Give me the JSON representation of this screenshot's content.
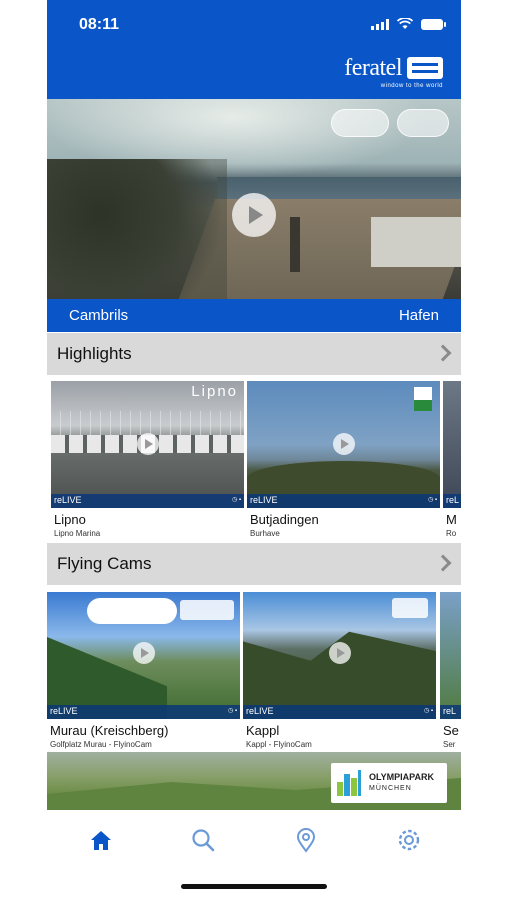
{
  "status_bar": {
    "time": "08:11"
  },
  "brand": {
    "name": "feratel",
    "tagline": "window to the world"
  },
  "hero": {
    "location": "Cambrils",
    "camera": "Hafen"
  },
  "sections": {
    "highlights": {
      "title": "Highlights",
      "cards": [
        {
          "title": "Lipno",
          "subtitle": "Lipno Marina",
          "badge": "reLIVE",
          "overlay_text": "Lipno"
        },
        {
          "title": "Butjadingen",
          "subtitle": "Burhave",
          "badge": "reLIVE"
        },
        {
          "title": "M",
          "subtitle": "Ro",
          "badge": "reL"
        }
      ]
    },
    "flying_cams": {
      "title": "Flying Cams",
      "cards": [
        {
          "title": "Murau (Kreischberg)",
          "subtitle": "Golfplatz Murau - FlyinoCam",
          "badge": "reLIVE"
        },
        {
          "title": "Kappl",
          "subtitle": "Kappl - FlyinoCam",
          "badge": "reLIVE"
        },
        {
          "title": "Se",
          "subtitle": "Ser",
          "badge": "reL"
        }
      ]
    }
  },
  "banner": {
    "name": "OLYMPIAPARK",
    "city": "MÜNCHEN"
  },
  "tabbar": [
    "home-icon",
    "search-icon",
    "map-pin-icon",
    "gear-icon"
  ],
  "colors": {
    "primary": "#0a55c8",
    "section_bg": "#d9d9d9",
    "tab_icon": "#0a55c8"
  }
}
